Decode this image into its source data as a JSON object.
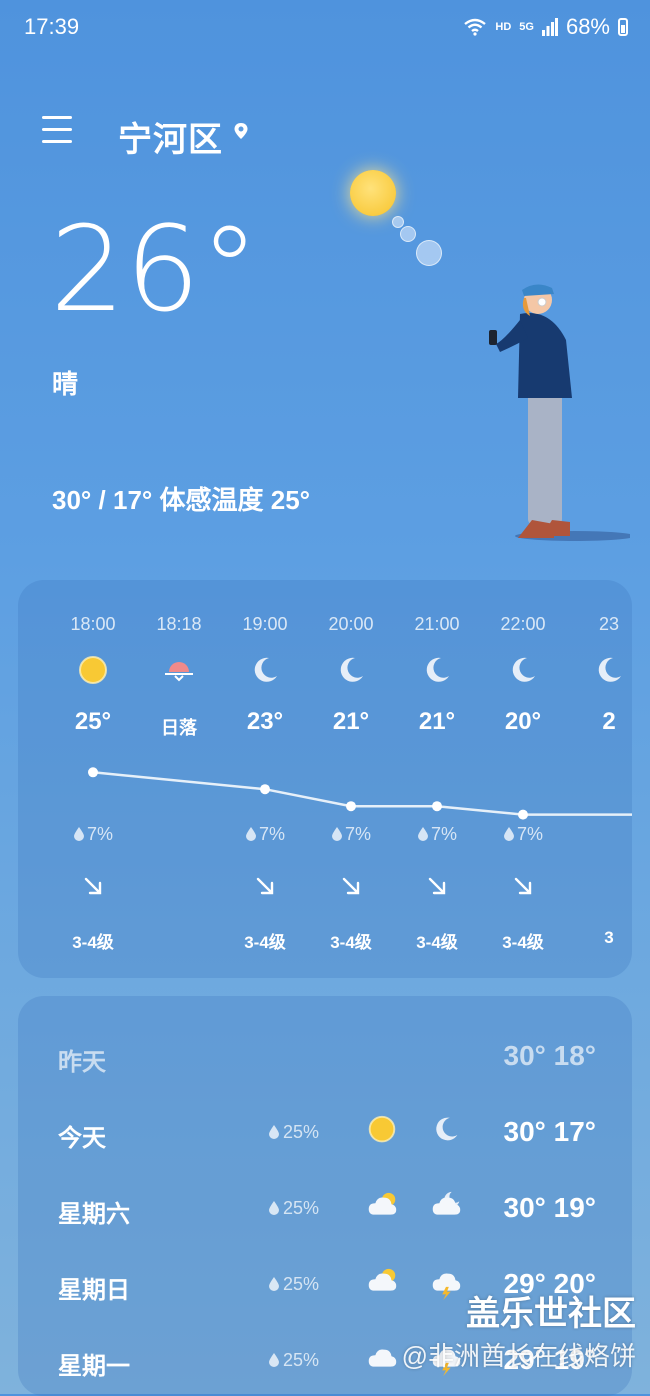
{
  "status": {
    "time": "17:39",
    "hd": "HD",
    "net": "5G",
    "battery": "68%"
  },
  "header": {
    "city": "宁河区",
    "menu_icon": "menu-icon",
    "location_icon": "location-pin-icon"
  },
  "current": {
    "temp": "26°",
    "condition": "晴",
    "range": "30° / 17° 体感温度 25°"
  },
  "hourly": [
    {
      "time": "18:00",
      "icon": "sun-icon",
      "temp": "25°",
      "label": "",
      "rain": "7%",
      "wind": "3-4级",
      "value": 25
    },
    {
      "time": "18:18",
      "icon": "sunset-icon",
      "temp": "",
      "label": "日落",
      "rain": "",
      "wind": "",
      "value": null
    },
    {
      "time": "19:00",
      "icon": "moon-icon",
      "temp": "23°",
      "label": "",
      "rain": "7%",
      "wind": "3-4级",
      "value": 23
    },
    {
      "time": "20:00",
      "icon": "moon-icon",
      "temp": "21°",
      "label": "",
      "rain": "7%",
      "wind": "3-4级",
      "value": 21
    },
    {
      "time": "21:00",
      "icon": "moon-icon",
      "temp": "21°",
      "label": "",
      "rain": "7%",
      "wind": "3-4级",
      "value": 21
    },
    {
      "time": "22:00",
      "icon": "moon-icon",
      "temp": "20°",
      "label": "",
      "rain": "7%",
      "wind": "3-4级",
      "value": 20
    },
    {
      "time": "23",
      "icon": "moon-icon",
      "temp": "2",
      "label": "",
      "rain": "",
      "wind": "3",
      "value": 20
    }
  ],
  "daily": [
    {
      "day": "昨天",
      "rain": "",
      "icon_day": "",
      "icon_night": "",
      "temps": "30° 18°",
      "dim": true
    },
    {
      "day": "今天",
      "rain": "25%",
      "icon_day": "sun-icon",
      "icon_night": "moon-icon",
      "temps": "30° 17°"
    },
    {
      "day": "星期六",
      "rain": "25%",
      "icon_day": "partly-cloudy-day-icon",
      "icon_night": "partly-cloudy-night-icon",
      "temps": "30° 19°"
    },
    {
      "day": "星期日",
      "rain": "25%",
      "icon_day": "partly-cloudy-day-icon",
      "icon_night": "thunderstorm-icon",
      "temps": "29° 20°"
    },
    {
      "day": "星期一",
      "rain": "25%",
      "icon_day": "cloud-icon",
      "icon_night": "thunderstorm-icon",
      "temps": "29° 19°"
    }
  ],
  "watermark": {
    "line1": "盖乐世社区",
    "line2": "@非洲酋长在线烙饼"
  }
}
